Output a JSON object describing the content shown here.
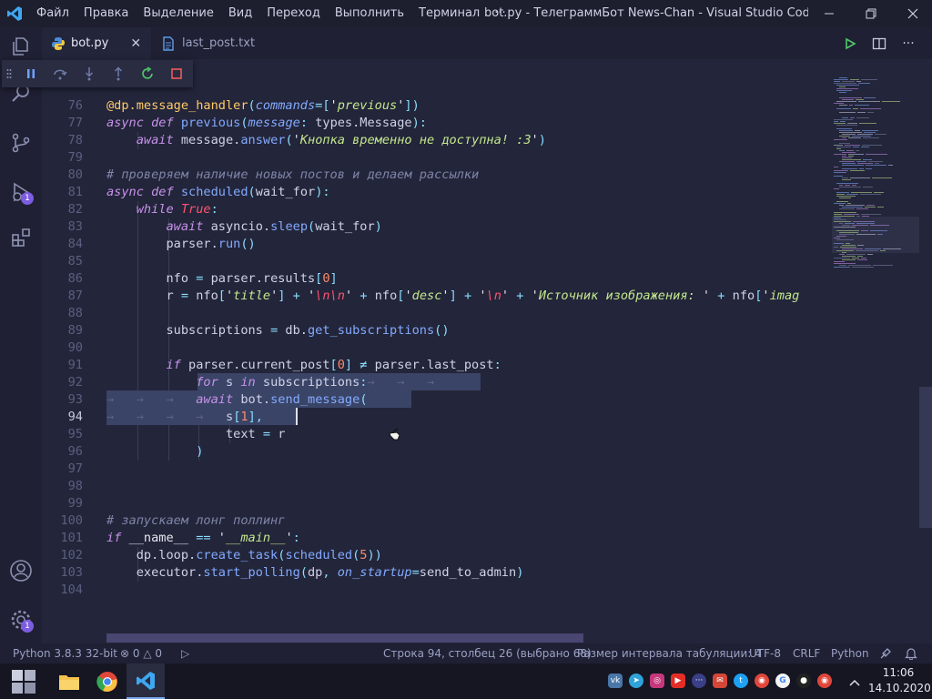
{
  "titlebar": {
    "menu": [
      "Файл",
      "Правка",
      "Выделение",
      "Вид",
      "Переход",
      "Выполнить",
      "Терминал",
      "···"
    ],
    "window_title": "bot.py - ТелеграммБот News-Chan - Visual Studio Code [Админ..."
  },
  "tabs": [
    {
      "label": "bot.py",
      "icon": "python-file-icon",
      "active": true
    },
    {
      "label": "last_post.txt",
      "icon": "text-file-icon",
      "active": false
    }
  ],
  "activity_badges": {
    "run_debug": "1",
    "settings": "1"
  },
  "editor": {
    "lines": [
      {
        "n": "76",
        "code": "@dp.message_handler(commands=['previous'])"
      },
      {
        "n": "77",
        "code": "async def previous(message: types.Message):"
      },
      {
        "n": "78",
        "code": "    await message.answer('Кнопка временно не доступна! :3')"
      },
      {
        "n": "79",
        "code": ""
      },
      {
        "n": "80",
        "code": "# проверяем наличие новых постов и делаем рассылки"
      },
      {
        "n": "81",
        "code": "async def scheduled(wait_for):"
      },
      {
        "n": "82",
        "code": "    while True:"
      },
      {
        "n": "83",
        "code": "        await asyncio.sleep(wait_for)"
      },
      {
        "n": "84",
        "code": "        parser.run()"
      },
      {
        "n": "85",
        "code": ""
      },
      {
        "n": "86",
        "code": "        nfo = parser.results[0]"
      },
      {
        "n": "87",
        "code": "        r = nfo['title'] + '\\n\\n' + nfo['desc'] + '\\n' + 'Источник изображения: ' + nfo['image"
      },
      {
        "n": "88",
        "code": ""
      },
      {
        "n": "89",
        "code": "        subscriptions = db.get_subscriptions()"
      },
      {
        "n": "90",
        "code": ""
      },
      {
        "n": "91",
        "code": "        if parser.current_post[0] ≠ parser.last_post:"
      },
      {
        "n": "92",
        "code": "            for s in subscriptions:→   →   →"
      },
      {
        "n": "93",
        "code": "→   →   →   await bot.send_message("
      },
      {
        "n": "94",
        "code": "→   →   →   →   s[1],"
      },
      {
        "n": "95",
        "code": "                text = r"
      },
      {
        "n": "96",
        "code": "            )"
      },
      {
        "n": "97",
        "code": ""
      },
      {
        "n": "98",
        "code": ""
      },
      {
        "n": "99",
        "code": ""
      },
      {
        "n": "100",
        "code": "# запускаем лонг поллинг"
      },
      {
        "n": "101",
        "code": "if __name__ == '__main__':"
      },
      {
        "n": "102",
        "code": "    dp.loop.create_task(scheduled(5))"
      },
      {
        "n": "103",
        "code": "    executor.start_polling(dp, on_startup=send_to_admin)"
      },
      {
        "n": "104",
        "code": ""
      }
    ]
  },
  "statusbar": {
    "interpreter": "Python 3.8.3 32-bit",
    "errors": "0",
    "warnings": "0",
    "position": "Строка 94, столбец 26 (выбрано 68)",
    "tab_size": "Размер интервала табуляции: 4",
    "encoding": "UTF-8",
    "eol": "CRLF",
    "language": "Python"
  },
  "taskbar": {
    "time": "11:06",
    "date": "14.10.2020"
  },
  "colors": {
    "editor_bg": "#23253a",
    "keyword": "#c792ea",
    "function": "#82aaff",
    "string": "#c3e88d",
    "comment": "#7f85a8",
    "accent": "#7c5ce0"
  }
}
